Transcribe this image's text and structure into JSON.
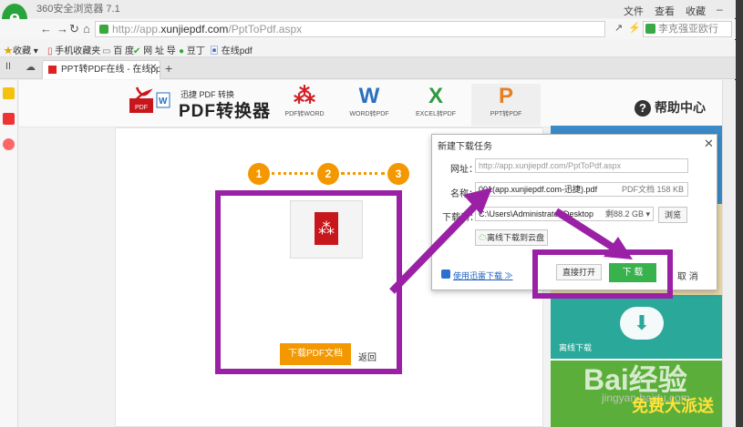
{
  "browser": {
    "title": "360安全浏览器 7.1",
    "menu": [
      "文件",
      "查看",
      "收藏"
    ],
    "url_prefix": "http://app.",
    "url_domain": "xunjiepdf.com",
    "url_path": "/PptToPdf.aspx",
    "search_placeholder": "李克强亚欧行"
  },
  "favorites": [
    {
      "label": "收藏"
    },
    {
      "label": "手机收藏夹"
    },
    {
      "label": "百 度"
    },
    {
      "label": "网 址 导"
    },
    {
      "label": "豆丁"
    },
    {
      "label": "在线pdf"
    }
  ],
  "tab": {
    "label": "PPT转PDF在线 - 在线ppt"
  },
  "site": {
    "brand_small": "迅捷 PDF 转换",
    "brand_big": "PDF转换器",
    "nav": [
      {
        "letter": "",
        "label": "PDF转WORD",
        "color": "#d32027"
      },
      {
        "letter": "W",
        "label": "WORD转PDF",
        "color": "#2b6fbf"
      },
      {
        "letter": "X",
        "label": "EXCEL转PDF",
        "color": "#2f9a3e"
      },
      {
        "letter": "P",
        "label": "PPT转PDF",
        "color": "#e67e22"
      }
    ],
    "help": "帮助中心",
    "steps": [
      "1",
      "2",
      "3"
    ],
    "download_btn": "下载PDF文档",
    "back": "返回",
    "offline_label": "离线下载",
    "watermark": "Bai经验",
    "watermark_sub": "jingyan.baidu.com",
    "promo": "免费大派送"
  },
  "dialog": {
    "title": "新建下载任务",
    "url_label": "网址：",
    "url_value": "http://app.xunjiepdf.com/PptToPdf.aspx",
    "name_label": "名称：",
    "name_value": "001(app.xunjiepdf.com-迅捷).pdf",
    "file_info": "PDF文档  158 KB",
    "dir_label": "下载到：",
    "dir_value": "C:\\Users\\Administrator\\Desktop",
    "free_space": "剩88.2 GB",
    "browse": "浏览",
    "cloud": "离线下载到云盘",
    "xunlei": "使用迅雷下载",
    "open_direct": "直接打开",
    "download": "下 载",
    "cancel": "取 消"
  },
  "colors": {
    "annotation": "#9a21a5",
    "accent_orange": "#f39800",
    "download_green": "#37b24d"
  }
}
